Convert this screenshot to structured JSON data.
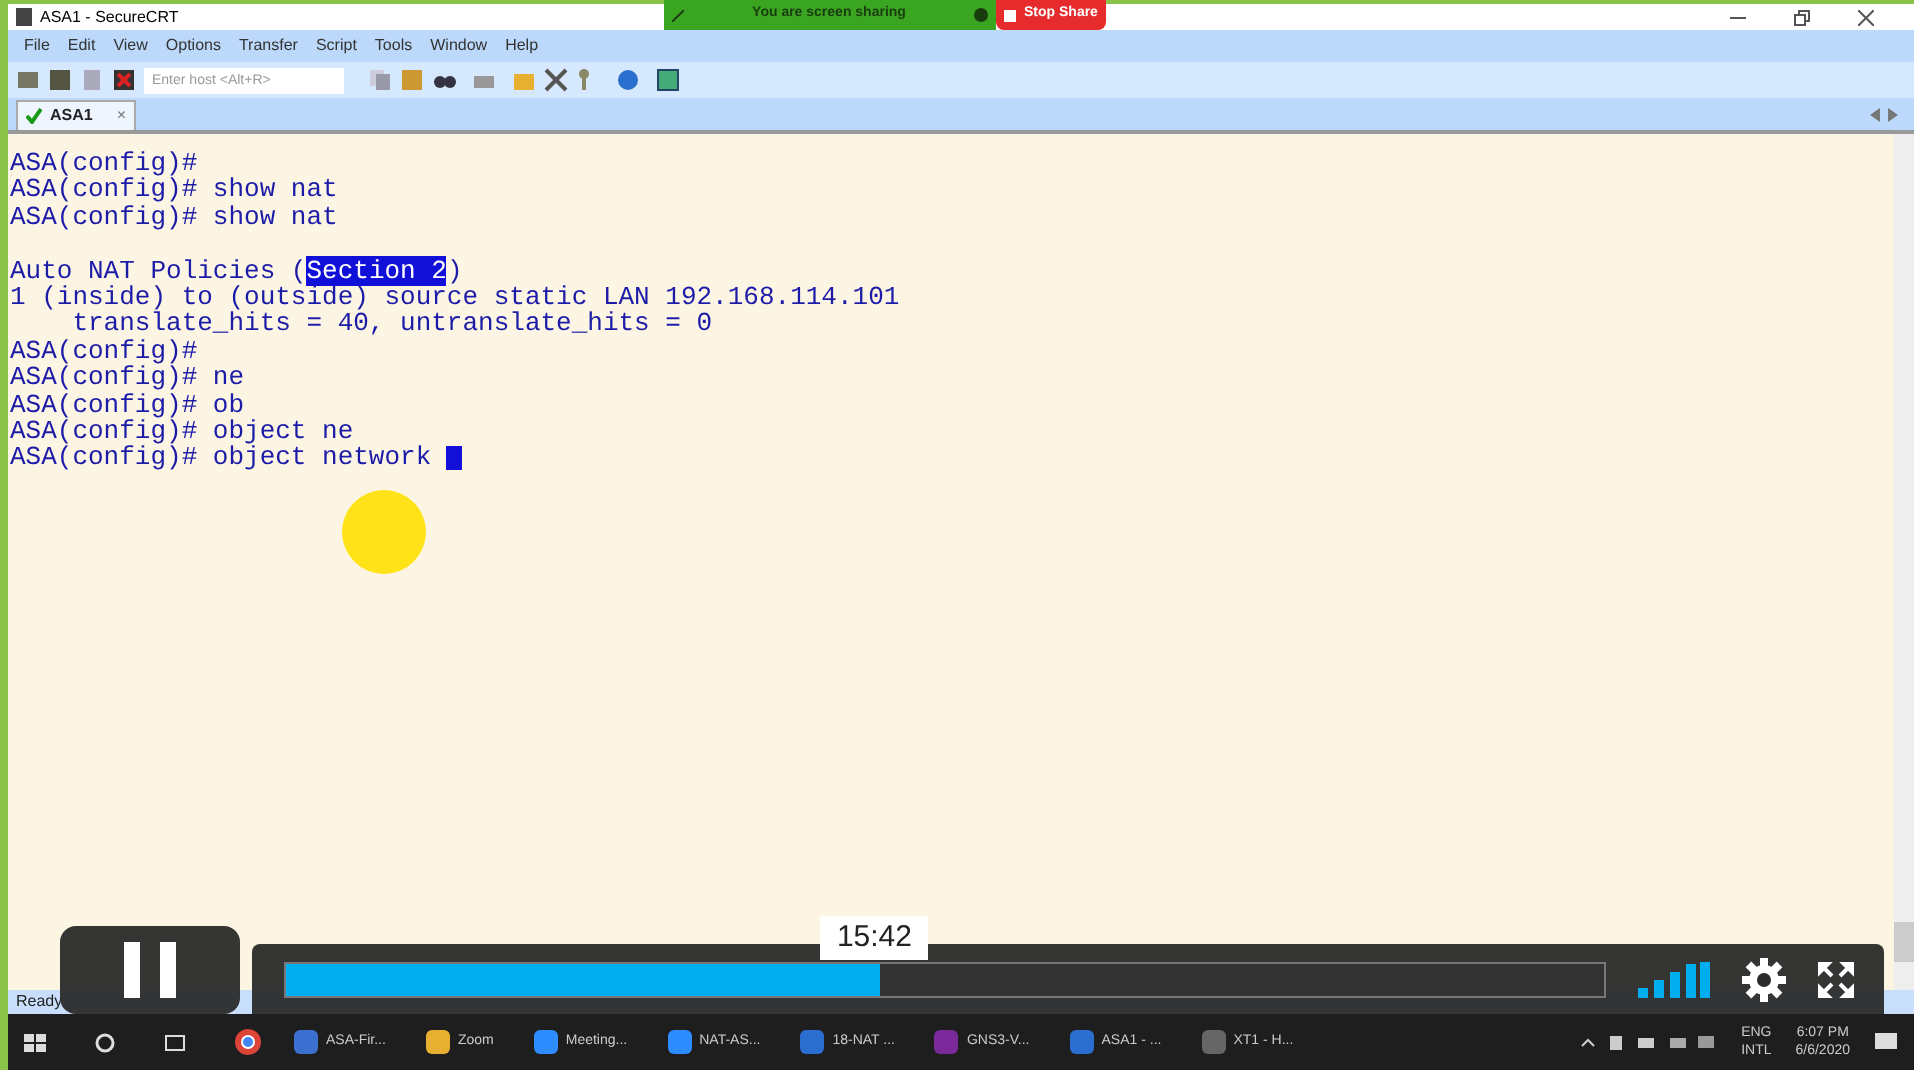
{
  "window": {
    "title": "ASA1 - SecureCRT"
  },
  "share_bar": {
    "status": "You are screen sharing",
    "stop_button": "Stop Share"
  },
  "menu": [
    "File",
    "Edit",
    "View",
    "Options",
    "Transfer",
    "Script",
    "Tools",
    "Window",
    "Help"
  ],
  "toolbar": {
    "host_field": {
      "placeholder": "Enter host <Alt+R>"
    }
  },
  "tabs": [
    {
      "label": "ASA1",
      "selected": true,
      "connected": true,
      "close": "×"
    }
  ],
  "terminal": {
    "cursor": true,
    "lines": [
      [
        {
          "text": "ASA(config)#",
          "selected": false
        }
      ],
      [
        {
          "text": "ASA(config)# show nat",
          "selected": false
        }
      ],
      [
        {
          "text": "ASA(config)# show nat",
          "selected": false
        }
      ],
      {
        "space_before": true,
        "segments": [
          {
            "text": "Auto NAT Policies (",
            "selected": false
          },
          {
            "text": "Section 2",
            "selected": true
          },
          {
            "text": ")",
            "selected": false
          }
        ]
      },
      [
        {
          "text": "1 (inside) to (outside) source static LAN 192.168.114.101",
          "selected": false
        }
      ],
      [
        {
          "text": "    translate_hits = 40, untranslate_hits = 0",
          "selected": false
        }
      ],
      [
        {
          "text": "ASA(config)#",
          "selected": false
        }
      ],
      [
        {
          "text": "ASA(config)# ne",
          "selected": false
        }
      ],
      [
        {
          "text": "ASA(config)# ob",
          "selected": false
        }
      ],
      [
        {
          "text": "ASA(config)# object ne",
          "selected": false
        }
      ],
      [
        {
          "text": "ASA(config)# object network ",
          "selected": false
        }
      ]
    ]
  },
  "status_bar": {
    "text": "Ready"
  },
  "taskbar": {
    "items": [
      "ASA-Fir...",
      "Zoom",
      "Meeting...",
      "NAT-AS...",
      "18-NAT ...",
      "GNS3-V...",
      "ASA1 - ...",
      "XT1 - H..."
    ],
    "language": [
      "ENG",
      "INTL"
    ],
    "time": "6:07 PM",
    "date": "6/6/2020"
  },
  "player": {
    "playing": true,
    "progress": {
      "level": 0.45
    },
    "time": "15:42"
  }
}
